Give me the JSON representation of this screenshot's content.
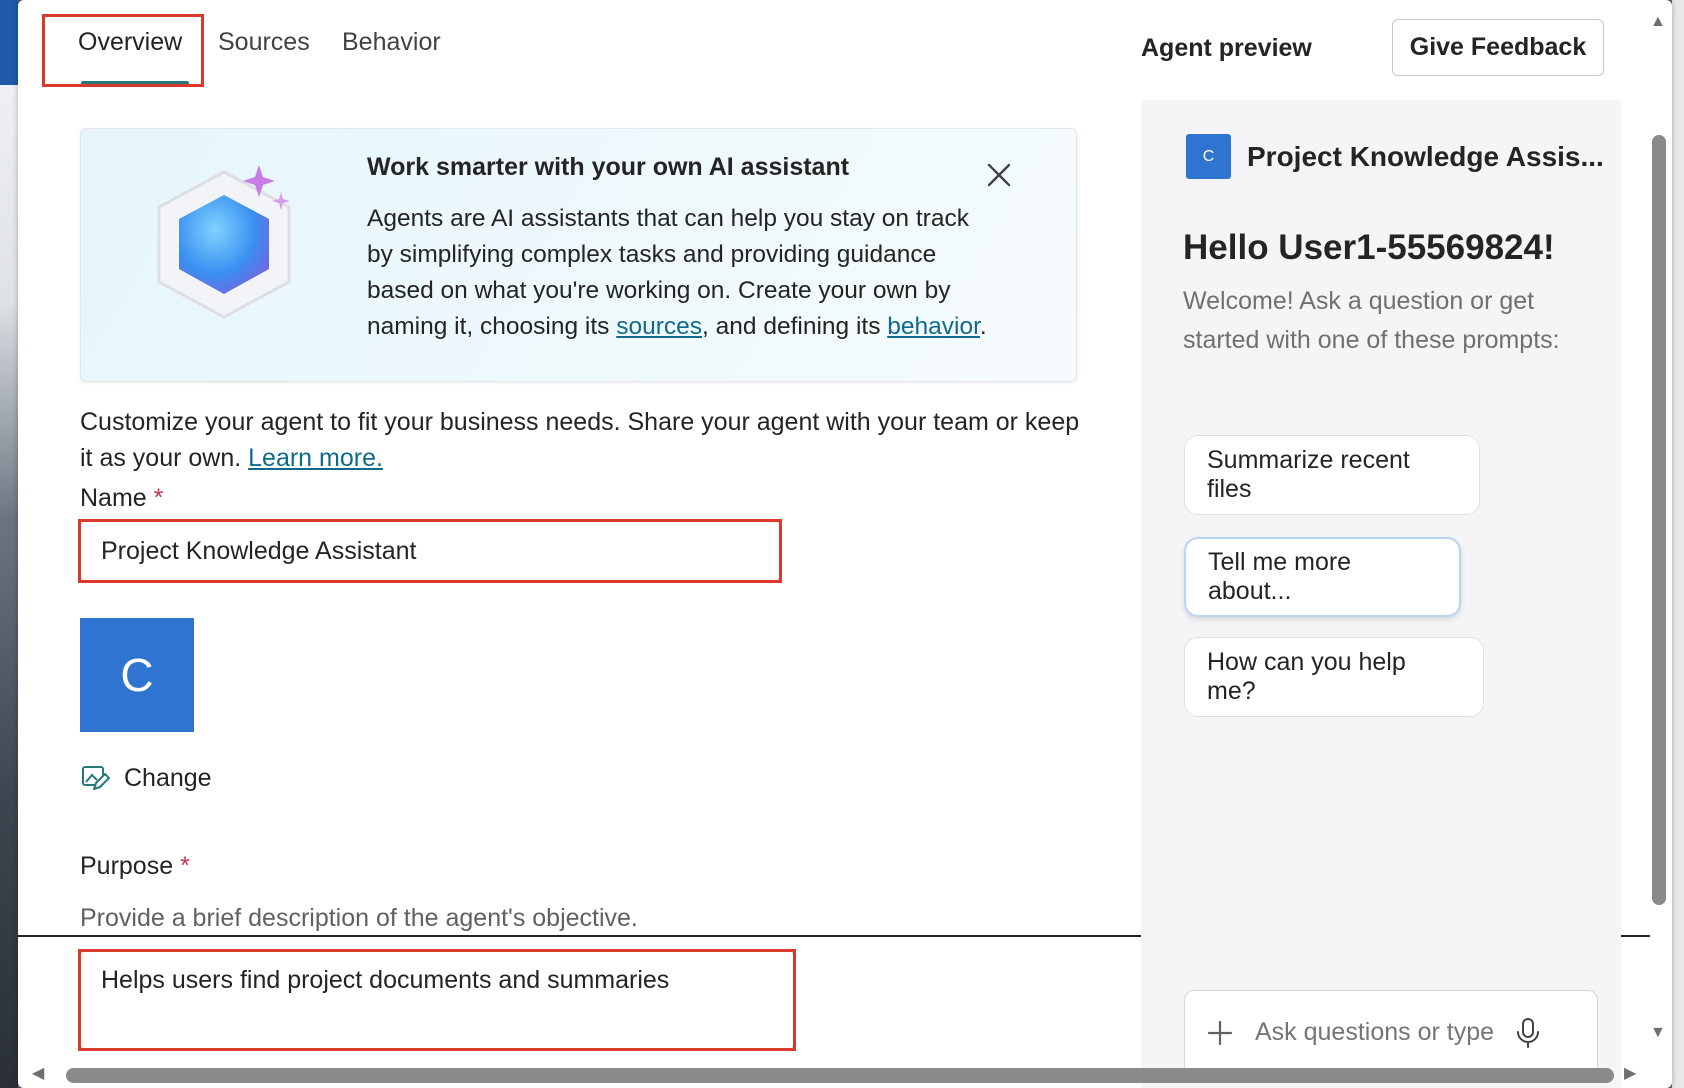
{
  "tabs": {
    "overview": "Overview",
    "sources": "Sources",
    "behavior": "Behavior"
  },
  "banner": {
    "title": "Work smarter with your own AI assistant",
    "body_part1": "Agents are AI assistants that can help you stay on track by simplifying complex tasks and providing guidance based on what you're working on. Create your own by naming it, choosing its ",
    "sources_link": "sources",
    "body_part2": ", and defining its ",
    "behavior_link": "behavior",
    "body_end": "."
  },
  "intro": {
    "text": "Customize your agent to fit your business needs. Share your agent with your team or keep it as your own. ",
    "learn_more": "Learn more."
  },
  "name_field": {
    "label": "Name",
    "required_mark": "*",
    "value": "Project Knowledge Assistant"
  },
  "avatar": {
    "letter": "C"
  },
  "change_label": "Change",
  "purpose_field": {
    "label": "Purpose",
    "required_mark": "*",
    "hint": "Provide a brief description of the agent's objective.",
    "value": "Helps users find project documents and summaries"
  },
  "preview": {
    "title": "Agent preview",
    "feedback_button": "Give Feedback",
    "agent_icon_letter": "C",
    "agent_name": "Project Knowledge Assis...",
    "greeting": "Hello User1-55569824!",
    "welcome": "Welcome! Ask a question or get started with one of these prompts:",
    "prompts": [
      "Summarize recent files",
      "Tell me more about...",
      "How can you help me?"
    ],
    "ask_placeholder": "Ask questions or type"
  },
  "colors": {
    "accent": "#257a77",
    "avatar_blue": "#2f74d0",
    "highlight_red": "#d93a2b",
    "link": "#0f6a8e"
  },
  "icons": {
    "close": "close-icon",
    "change": "edit-image-icon",
    "plus": "plus-icon",
    "mic": "microphone-icon"
  }
}
